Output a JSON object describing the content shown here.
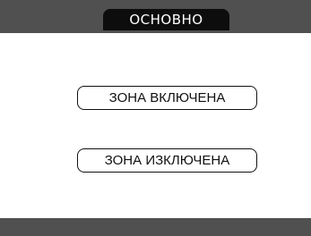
{
  "header": {
    "title": "ОСНОВНО"
  },
  "zones": {
    "enable_label": "ЗОНА ВКЛЮЧЕНА",
    "disable_label": "ЗОНА ИЗКЛЮЧЕНА"
  },
  "colors": {
    "bar": "#505050",
    "title_tab": "#0d0d0d",
    "background": "#ffffff",
    "text": "#111111"
  }
}
